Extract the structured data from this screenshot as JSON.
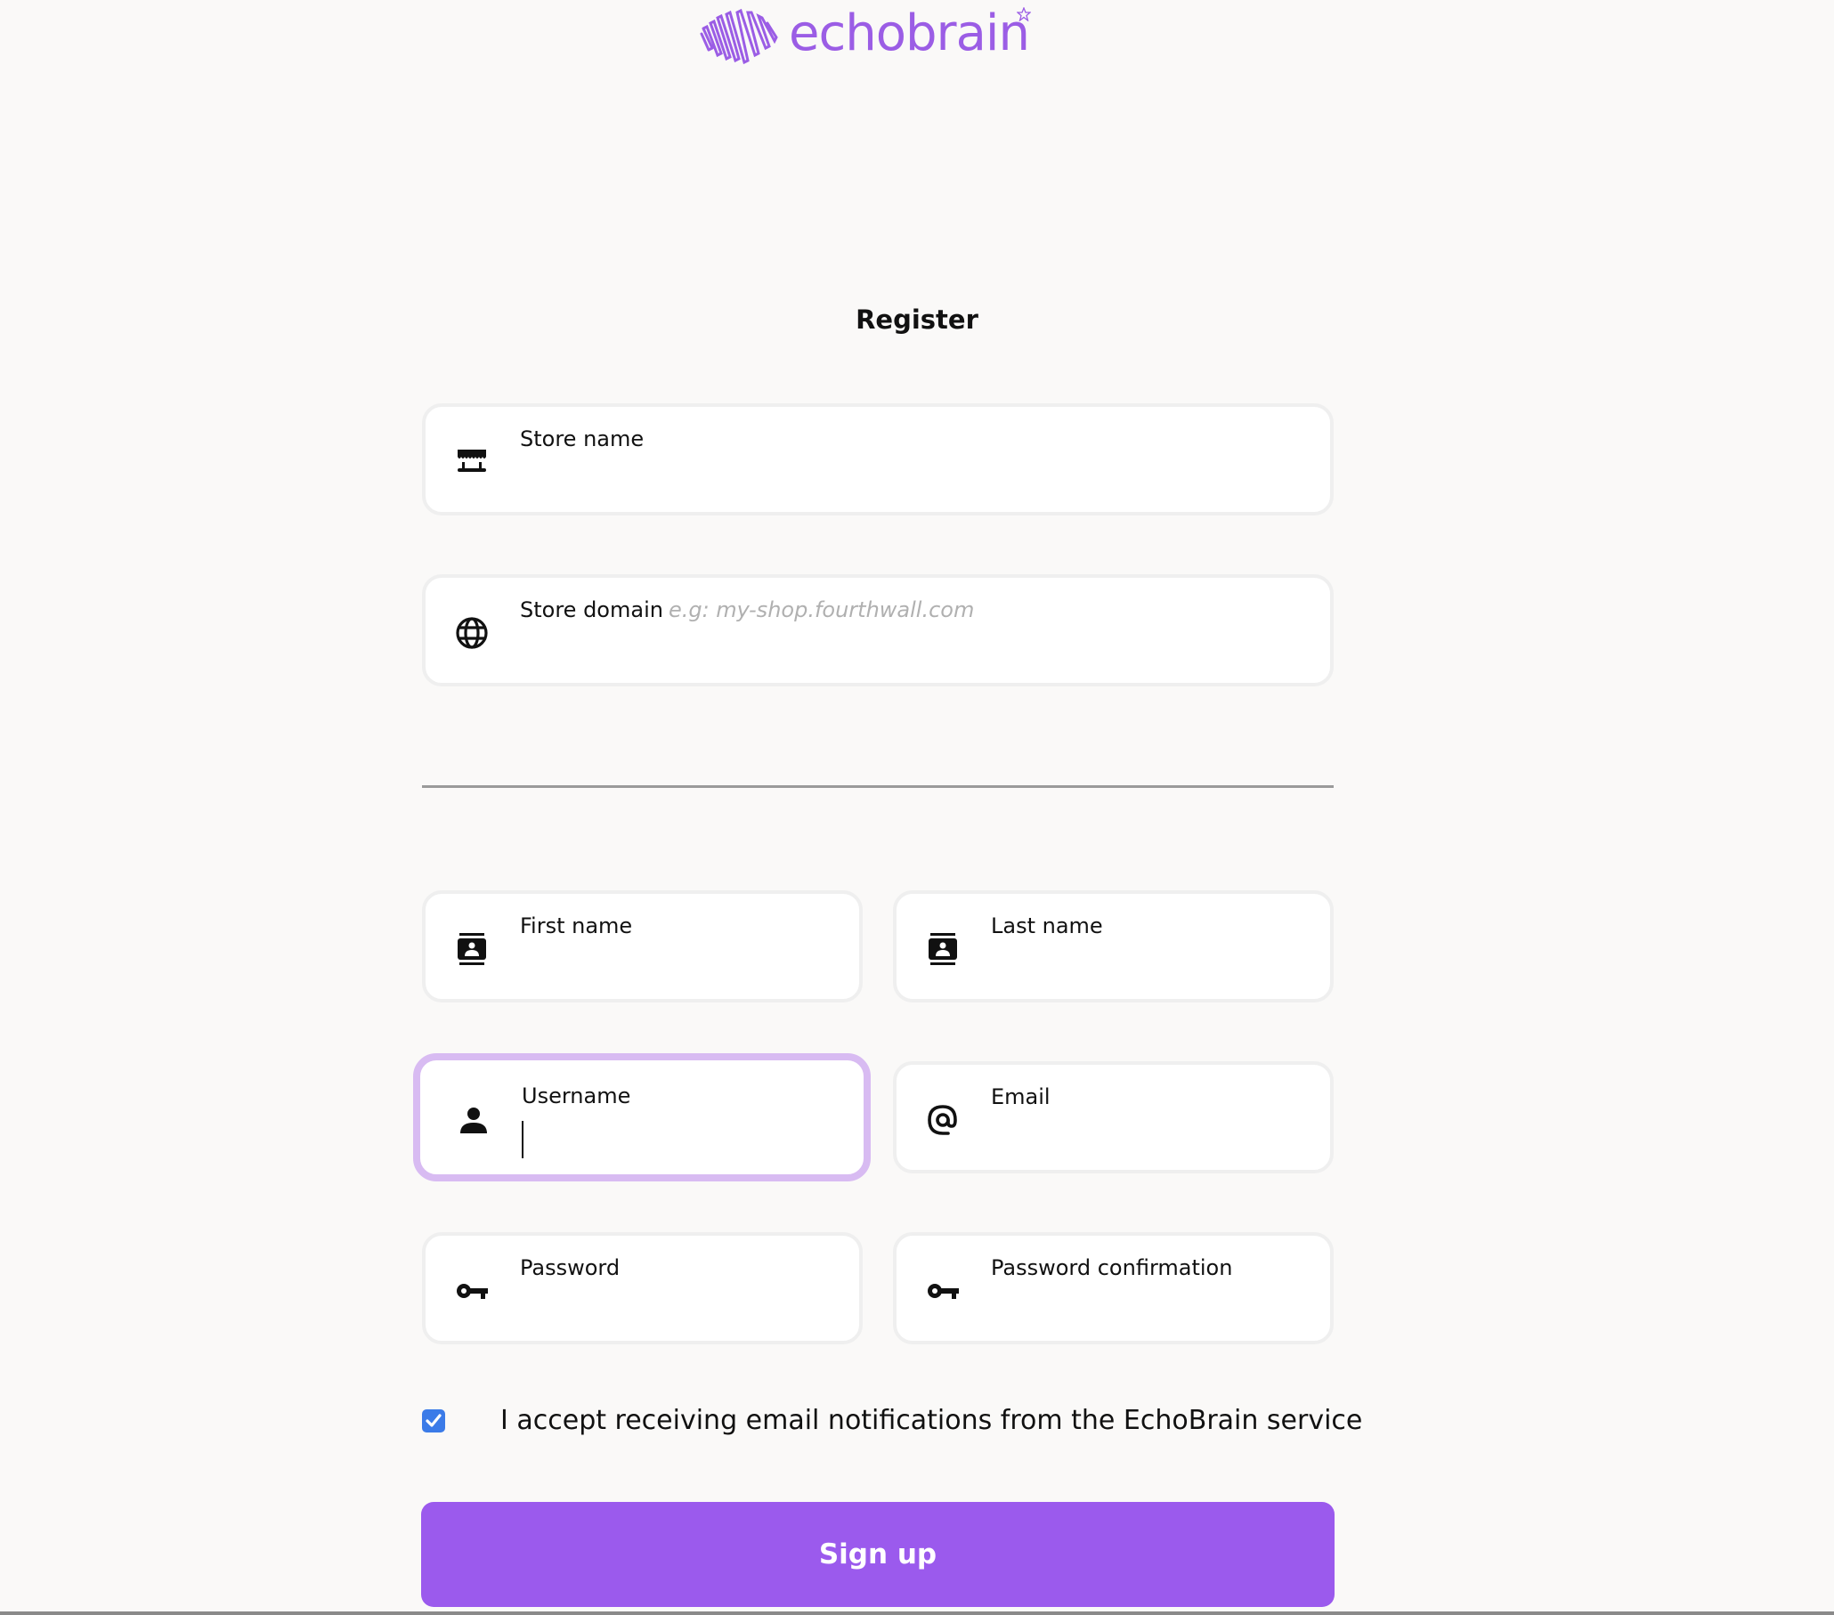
{
  "brand": {
    "name": "echobrain",
    "accent_color": "#9b5de5",
    "icon": "brain-logo-icon"
  },
  "page": {
    "title": "Register"
  },
  "store_section": {
    "store_name": {
      "label": "Store name",
      "icon": "storefront-icon",
      "value": ""
    },
    "store_domain": {
      "label": "Store domain",
      "placeholder": "e.g: my-shop.fourthwall.com",
      "icon": "globe-icon",
      "value": ""
    }
  },
  "user_section": {
    "first_name": {
      "label": "First name",
      "icon": "contact-card-icon",
      "value": ""
    },
    "last_name": {
      "label": "Last name",
      "icon": "contact-card-icon",
      "value": ""
    },
    "username": {
      "label": "Username",
      "icon": "person-icon",
      "value": "",
      "focused": true
    },
    "email": {
      "label": "Email",
      "icon": "at-sign-icon",
      "value": ""
    },
    "password": {
      "label": "Password",
      "icon": "key-icon",
      "value": ""
    },
    "password_confirmation": {
      "label": "Password confirmation",
      "icon": "key-icon",
      "value": ""
    }
  },
  "consent": {
    "label": "I accept receiving email notifications from the EchoBrain service",
    "checked": true,
    "checkbox_color": "#3b7be8"
  },
  "actions": {
    "signup_label": "Sign up",
    "signup_color": "#9b5aed"
  }
}
